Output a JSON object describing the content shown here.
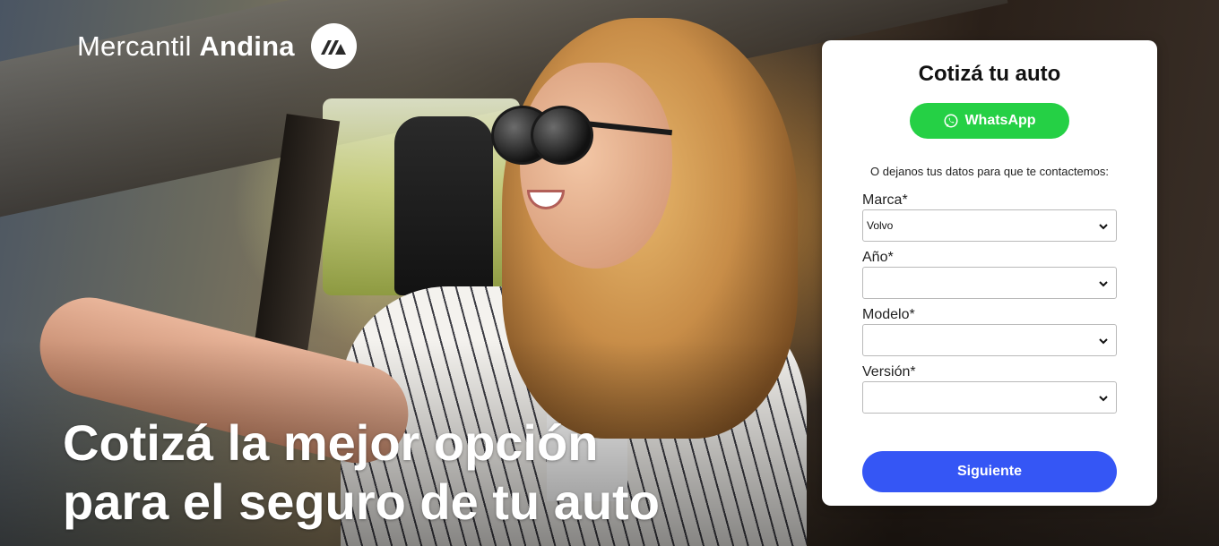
{
  "brand": {
    "name_light": "Mercantil",
    "name_bold": "Andina",
    "logo_icon": "mercantil-andina-logo",
    "logo_color": "#ffffff"
  },
  "hero": {
    "headline_line1": "Cotizá la mejor opción",
    "headline_line2": "para el seguro de tu auto"
  },
  "form": {
    "title": "Cotizá tu auto",
    "whatsapp_label": "WhatsApp",
    "whatsapp_icon": "whatsapp-icon",
    "whatsapp_color": "#25d045",
    "intro": "O dejanos tus datos para que te contactemos:",
    "fields": [
      {
        "label": "Marca*",
        "value": "Volvo"
      },
      {
        "label": "Año*",
        "value": ""
      },
      {
        "label": "Modelo*",
        "value": ""
      },
      {
        "label": "Versión*",
        "value": ""
      }
    ],
    "submit_label": "Siguiente",
    "submit_color": "#3556f5"
  }
}
